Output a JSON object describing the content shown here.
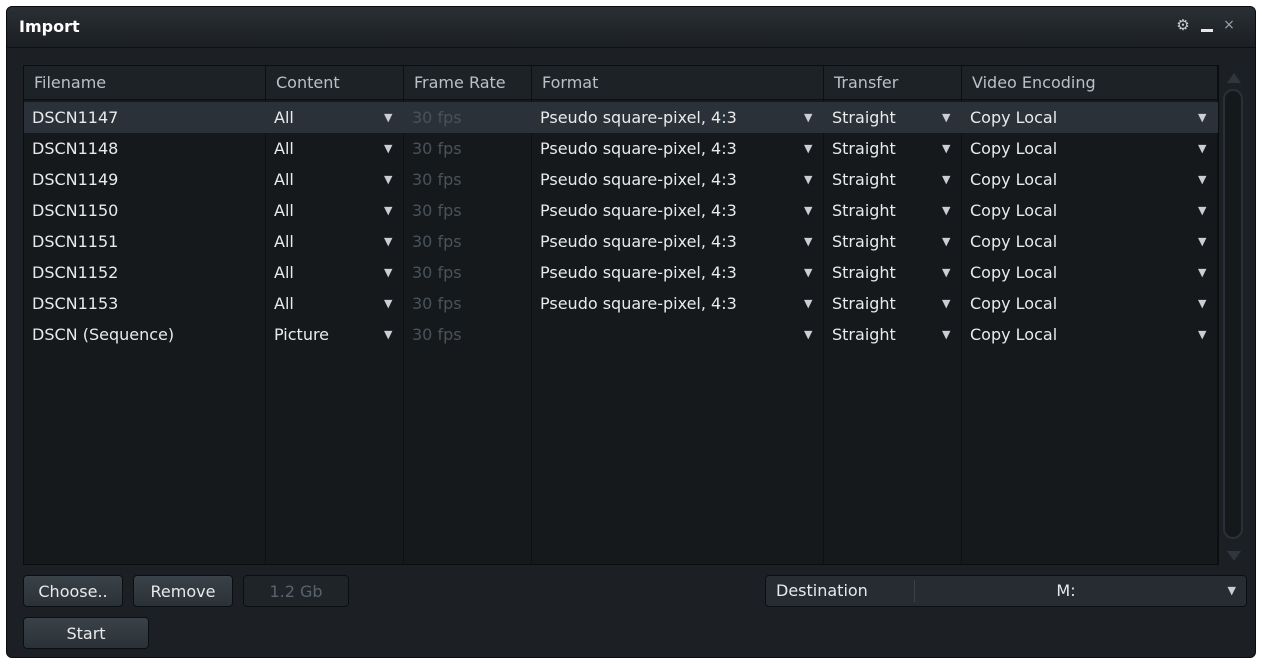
{
  "window": {
    "title": "Import"
  },
  "controls": {
    "gear": "⚙",
    "close": "×"
  },
  "table": {
    "columns": [
      "Filename",
      "Content",
      "Frame Rate",
      "Format",
      "Transfer",
      "Video Encoding"
    ],
    "rows": [
      {
        "filename": "DSCN1147",
        "content": "All",
        "frame_rate": "30 fps",
        "format": "Pseudo square-pixel, 4:3",
        "transfer": "Straight",
        "encoding": "Copy Local"
      },
      {
        "filename": "DSCN1148",
        "content": "All",
        "frame_rate": "30 fps",
        "format": "Pseudo square-pixel, 4:3",
        "transfer": "Straight",
        "encoding": "Copy Local"
      },
      {
        "filename": "DSCN1149",
        "content": "All",
        "frame_rate": "30 fps",
        "format": "Pseudo square-pixel, 4:3",
        "transfer": "Straight",
        "encoding": "Copy Local"
      },
      {
        "filename": "DSCN1150",
        "content": "All",
        "frame_rate": "30 fps",
        "format": "Pseudo square-pixel, 4:3",
        "transfer": "Straight",
        "encoding": "Copy Local"
      },
      {
        "filename": "DSCN1151",
        "content": "All",
        "frame_rate": "30 fps",
        "format": "Pseudo square-pixel, 4:3",
        "transfer": "Straight",
        "encoding": "Copy Local"
      },
      {
        "filename": "DSCN1152",
        "content": "All",
        "frame_rate": "30 fps",
        "format": "Pseudo square-pixel, 4:3",
        "transfer": "Straight",
        "encoding": "Copy Local"
      },
      {
        "filename": "DSCN1153",
        "content": "All",
        "frame_rate": "30 fps",
        "format": "Pseudo square-pixel, 4:3",
        "transfer": "Straight",
        "encoding": "Copy Local"
      },
      {
        "filename": "DSCN (Sequence)",
        "content": "Picture",
        "frame_rate": "30 fps",
        "format": "",
        "transfer": "Straight",
        "encoding": "Copy Local"
      }
    ]
  },
  "footer": {
    "choose_label": "Choose..",
    "remove_label": "Remove",
    "size_label": "1.2 Gb",
    "start_label": "Start",
    "destination_label": "Destination",
    "destination_value": "M:"
  }
}
